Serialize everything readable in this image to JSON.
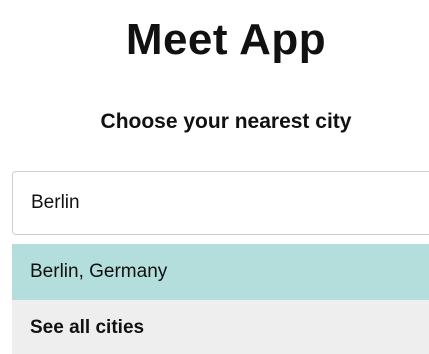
{
  "header": {
    "title": "Meet App",
    "subtitle": "Choose your nearest city"
  },
  "search": {
    "value": "Berlin"
  },
  "suggestions": {
    "items": [
      {
        "label": "Berlin, Germany"
      }
    ],
    "see_all_label": "See all cities"
  },
  "colors": {
    "highlight": "#b3dedc",
    "see_all_bg": "#eeeeee",
    "input_border": "#cfcfcf"
  }
}
